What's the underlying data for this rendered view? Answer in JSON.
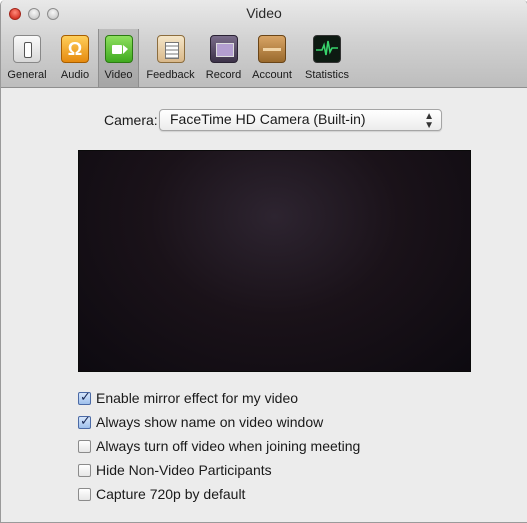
{
  "window": {
    "title": "Video"
  },
  "toolbar": {
    "items": [
      {
        "label": "General",
        "icon": "general-icon"
      },
      {
        "label": "Audio",
        "icon": "audio-icon"
      },
      {
        "label": "Video",
        "icon": "video-camera-icon",
        "selected": true
      },
      {
        "label": "Feedback",
        "icon": "feedback-icon"
      },
      {
        "label": "Record",
        "icon": "record-icon"
      },
      {
        "label": "Account",
        "icon": "account-wallet-icon"
      },
      {
        "label": "Statistics",
        "icon": "statistics-icon"
      }
    ]
  },
  "camera": {
    "label": "Camera:",
    "selected": "FaceTime HD Camera (Built-in)"
  },
  "options": [
    {
      "label": "Enable mirror effect for my video",
      "checked": true
    },
    {
      "label": "Always show name on video window",
      "checked": true
    },
    {
      "label": "Always turn off video when joining meeting",
      "checked": false
    },
    {
      "label": "Hide Non-Video Participants",
      "checked": false
    },
    {
      "label": "Capture 720p by default",
      "checked": false
    }
  ],
  "colors": {
    "accent": "#4b6aa6",
    "preview_background": "#1a1219"
  }
}
